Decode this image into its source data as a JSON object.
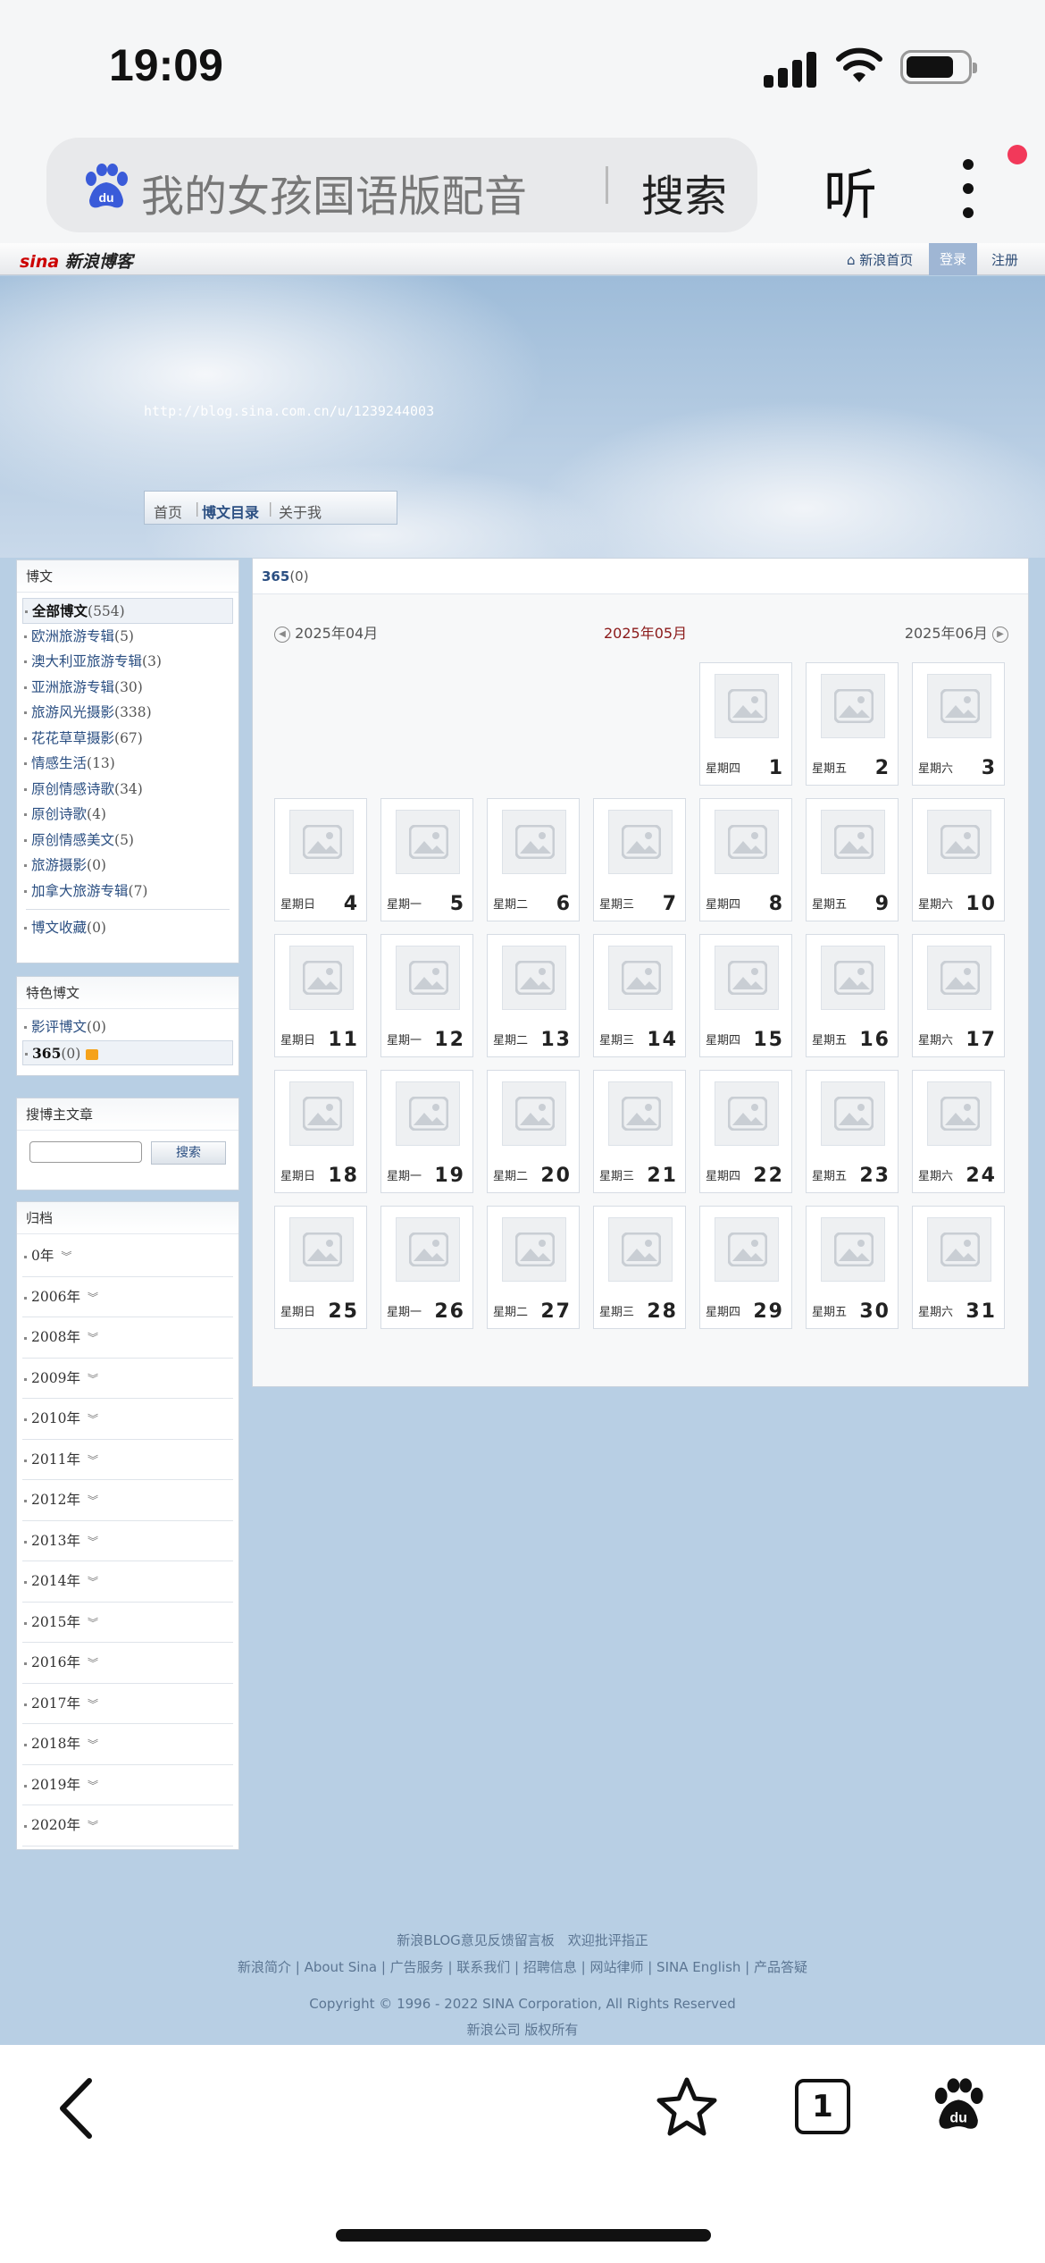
{
  "status_bar": {
    "time": "19:09"
  },
  "browser": {
    "search_query": "我的女孩国语版配音",
    "search_button": "搜索",
    "listen_button": "听",
    "tab_count": "1"
  },
  "sina_nav": {
    "logo": "sina",
    "logo_text": "新浪博客",
    "home_link": "⌂ 新浪首页",
    "login": "登录",
    "register": "注册"
  },
  "banner": {
    "url": "http://blog.sina.com.cn/u/1239244003",
    "tabs": [
      "首页",
      "博文目录",
      "关于我"
    ]
  },
  "sidebar": {
    "blog_posts": {
      "title": "博文",
      "items": [
        {
          "label": "全部博文",
          "count": "(554)"
        },
        {
          "label": "欧洲旅游专辑",
          "count": "(5)"
        },
        {
          "label": "澳大利亚旅游专辑",
          "count": "(3)"
        },
        {
          "label": "亚洲旅游专辑",
          "count": "(30)"
        },
        {
          "label": "旅游风光摄影",
          "count": "(338)"
        },
        {
          "label": "花花草草摄影",
          "count": "(67)"
        },
        {
          "label": "情感生活",
          "count": "(13)"
        },
        {
          "label": "原创情感诗歌",
          "count": "(34)"
        },
        {
          "label": "原创诗歌",
          "count": "(4)"
        },
        {
          "label": "原创情感美文",
          "count": "(5)"
        },
        {
          "label": "旅游摄影",
          "count": "(0)"
        },
        {
          "label": "加拿大旅游专辑",
          "count": "(7)"
        }
      ],
      "collection": {
        "label": "博文收藏",
        "count": "(0)"
      }
    },
    "featured": {
      "title": "特色博文",
      "items": [
        {
          "label": "影评博文",
          "count": "(0)"
        },
        {
          "label": "365",
          "count": "(0)"
        }
      ]
    },
    "search": {
      "title": "搜博主文章",
      "button": "搜索"
    },
    "archive": {
      "title": "归档",
      "items": [
        "0年",
        "2006年",
        "2008年",
        "2009年",
        "2010年",
        "2011年",
        "2012年",
        "2013年",
        "2014年",
        "2015年",
        "2016年",
        "2017年",
        "2018年",
        "2019年",
        "2020年"
      ]
    }
  },
  "main": {
    "title": "365",
    "title_count": "(0)",
    "prev_month": "2025年04月",
    "current_month": "2025年05月",
    "next_month": "2025年06月",
    "days": [
      {
        "wd": "星期四",
        "d": "1"
      },
      {
        "wd": "星期五",
        "d": "2"
      },
      {
        "wd": "星期六",
        "d": "3"
      },
      {
        "wd": "星期日",
        "d": "4"
      },
      {
        "wd": "星期一",
        "d": "5"
      },
      {
        "wd": "星期二",
        "d": "6"
      },
      {
        "wd": "星期三",
        "d": "7"
      },
      {
        "wd": "星期四",
        "d": "8"
      },
      {
        "wd": "星期五",
        "d": "9"
      },
      {
        "wd": "星期六",
        "d": "10"
      },
      {
        "wd": "星期日",
        "d": "11"
      },
      {
        "wd": "星期一",
        "d": "12"
      },
      {
        "wd": "星期二",
        "d": "13"
      },
      {
        "wd": "星期三",
        "d": "14"
      },
      {
        "wd": "星期四",
        "d": "15"
      },
      {
        "wd": "星期五",
        "d": "16"
      },
      {
        "wd": "星期六",
        "d": "17"
      },
      {
        "wd": "星期日",
        "d": "18"
      },
      {
        "wd": "星期一",
        "d": "19"
      },
      {
        "wd": "星期二",
        "d": "20"
      },
      {
        "wd": "星期三",
        "d": "21"
      },
      {
        "wd": "星期四",
        "d": "22"
      },
      {
        "wd": "星期五",
        "d": "23"
      },
      {
        "wd": "星期六",
        "d": "24"
      },
      {
        "wd": "星期日",
        "d": "25"
      },
      {
        "wd": "星期一",
        "d": "26"
      },
      {
        "wd": "星期二",
        "d": "27"
      },
      {
        "wd": "星期三",
        "d": "28"
      },
      {
        "wd": "星期四",
        "d": "29"
      },
      {
        "wd": "星期五",
        "d": "30"
      },
      {
        "wd": "星期六",
        "d": "31"
      }
    ]
  },
  "footer": {
    "line1": "新浪BLOG意见反馈留言板　欢迎批评指正",
    "line2": "新浪简介 | About Sina | 广告服务 | 联系我们 | 招聘信息 | 网站律师 | SINA English | 产品答疑",
    "line3": "Copyright © 1996 - 2022 SINA Corporation, All Rights Reserved",
    "line4": "新浪公司 版权所有"
  }
}
